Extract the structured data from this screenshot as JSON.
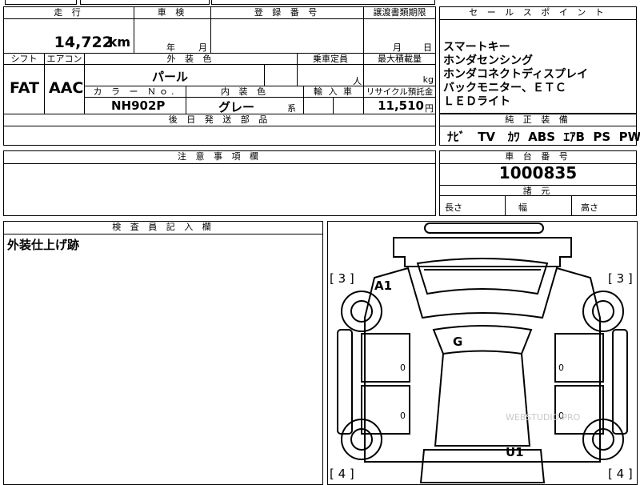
{
  "header": {
    "mileage_label": "走 行",
    "inspection_label": "車 検",
    "registration_label": "登 録 番 号",
    "transfer_label": "譲渡書類期限",
    "sales_point_label": "セ ー ル ス ポ イ ン ト"
  },
  "row1": {
    "mileage_value": "14,722",
    "mileage_unit": "km",
    "inspection_year": "年",
    "inspection_month": "月",
    "transfer_month": "月",
    "transfer_day": "日"
  },
  "row2_labels": {
    "shift": "シフト",
    "aircon": "エアコン",
    "exterior_color": "外 装 色",
    "capacity": "乗車定員",
    "max_load": "最大積載量"
  },
  "row2": {
    "shift_value": "FAT",
    "aircon_value": "AAC",
    "exterior_color_value": "パール",
    "capacity_unit": "人",
    "load_unit": "kg"
  },
  "row3_labels": {
    "color_no": "カ ラ ー Ｎｏ.",
    "interior_color": "内 装 色",
    "import": "輸 入 車",
    "recycle": "リサイクル預託金"
  },
  "row3": {
    "color_no_value": "NH902P",
    "interior_color_value": "グレー",
    "interior_suffix": "系",
    "recycle_value": "11,510",
    "recycle_unit": "円"
  },
  "delivery_label": "後 日 発 送 部 品",
  "sales_points": [
    "スマートキー",
    "ホンダセンシング",
    "ホンダコネクトディスプレイ",
    "バックモニター、ＥＴＣ",
    "ＬＥＤライト"
  ],
  "equipment_label": "純 正 装 備",
  "equipment": [
    "ﾅﾋﾞ",
    "TV",
    "ｶﾜ",
    "ABS",
    "ｴｱB",
    "PS",
    "PW"
  ],
  "notes_label": "注 意 事 項 欄",
  "chassis_label": "車 台 番 号",
  "chassis_value": "1000835",
  "dimensions_label": "諸 元",
  "dimensions": {
    "length": "長さ",
    "width": "幅",
    "height": "高さ"
  },
  "inspector_label": "検 査 員 記 入 欄",
  "inspector_note": "外装仕上げ跡",
  "diagram": {
    "front_left_bracket": "[ 3 ]",
    "front_right_bracket": "[ 3 ]",
    "rear_left_bracket": "[ 4 ]",
    "rear_right_bracket": "[ 4 ]",
    "mark_a1": "A1",
    "mark_g": "G",
    "mark_u1": "U1",
    "zero_mark": "0",
    "watermark": "WEBSTUDIO.PRO"
  }
}
